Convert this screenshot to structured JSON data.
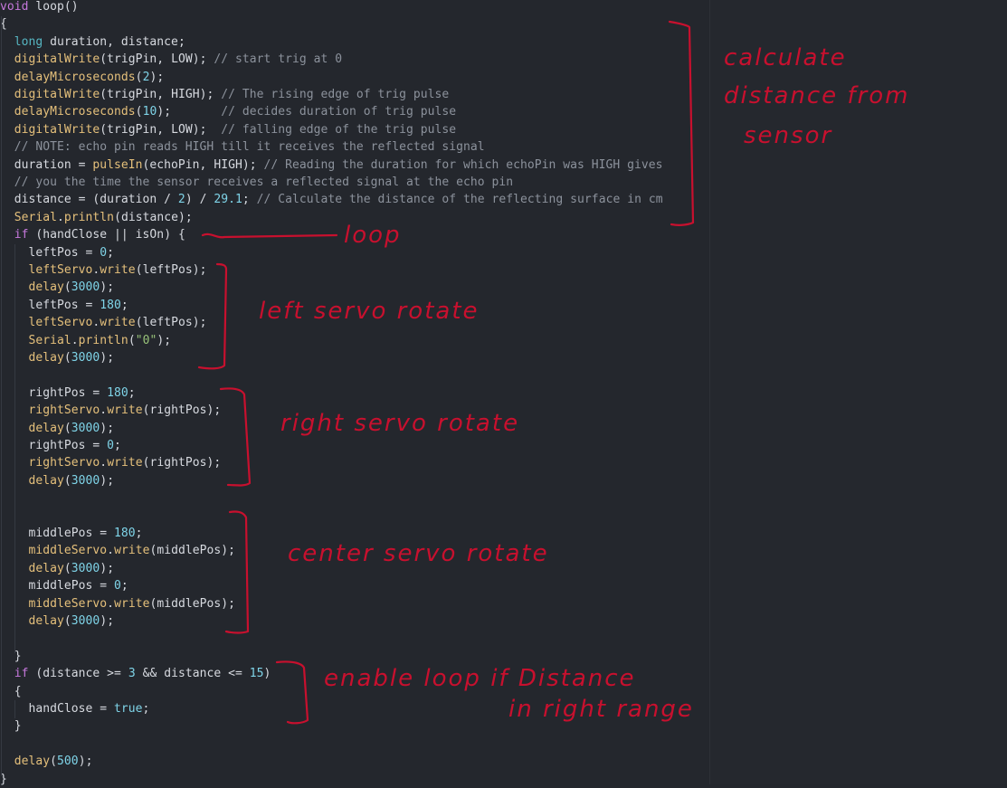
{
  "code": {
    "lines": [
      [
        {
          "t": "void",
          "c": "kw"
        },
        {
          "t": " loop()",
          "c": "punc"
        }
      ],
      [
        {
          "t": "{",
          "c": "punc"
        }
      ],
      [
        {
          "t": "  "
        },
        {
          "t": "long",
          "c": "type"
        },
        {
          "t": " duration, distance;"
        }
      ],
      [
        {
          "t": "  "
        },
        {
          "t": "digitalWrite",
          "c": "fn"
        },
        {
          "t": "(trigPin, LOW); "
        },
        {
          "t": "// start trig at 0",
          "c": "cm"
        }
      ],
      [
        {
          "t": "  "
        },
        {
          "t": "delayMicroseconds",
          "c": "fn"
        },
        {
          "t": "("
        },
        {
          "t": "2",
          "c": "num"
        },
        {
          "t": ");"
        }
      ],
      [
        {
          "t": "  "
        },
        {
          "t": "digitalWrite",
          "c": "fn"
        },
        {
          "t": "(trigPin, HIGH); "
        },
        {
          "t": "// The rising edge of trig pulse",
          "c": "cm"
        }
      ],
      [
        {
          "t": "  "
        },
        {
          "t": "delayMicroseconds",
          "c": "fn"
        },
        {
          "t": "("
        },
        {
          "t": "10",
          "c": "num"
        },
        {
          "t": ");       "
        },
        {
          "t": "// decides duration of trig pulse",
          "c": "cm"
        }
      ],
      [
        {
          "t": "  "
        },
        {
          "t": "digitalWrite",
          "c": "fn"
        },
        {
          "t": "(trigPin, LOW);  "
        },
        {
          "t": "// falling edge of the trig pulse",
          "c": "cm"
        }
      ],
      [
        {
          "t": "  "
        },
        {
          "t": "// NOTE: echo pin reads HIGH till it receives the reflected signal",
          "c": "cm"
        }
      ],
      [
        {
          "t": "  duration = "
        },
        {
          "t": "pulseIn",
          "c": "fn"
        },
        {
          "t": "(echoPin, HIGH); "
        },
        {
          "t": "// Reading the duration for which echoPin was HIGH gives",
          "c": "cm"
        }
      ],
      [
        {
          "t": "  "
        },
        {
          "t": "// you the time the sensor receives a reflected signal at the echo pin",
          "c": "cm"
        }
      ],
      [
        {
          "t": "  distance = (duration / "
        },
        {
          "t": "2",
          "c": "num"
        },
        {
          "t": ") / "
        },
        {
          "t": "29.1",
          "c": "num"
        },
        {
          "t": "; "
        },
        {
          "t": "// Calculate the distance of the reflecting surface in cm",
          "c": "cm"
        }
      ],
      [
        {
          "t": "  "
        },
        {
          "t": "Serial",
          "c": "fn"
        },
        {
          "t": "."
        },
        {
          "t": "println",
          "c": "fn"
        },
        {
          "t": "(distance);"
        }
      ],
      [
        {
          "t": "  "
        },
        {
          "t": "if",
          "c": "kw"
        },
        {
          "t": " (handClose || isOn) {"
        }
      ],
      [
        {
          "t": "    leftPos = "
        },
        {
          "t": "0",
          "c": "num"
        },
        {
          "t": ";"
        }
      ],
      [
        {
          "t": "    "
        },
        {
          "t": "leftServo",
          "c": "fn"
        },
        {
          "t": "."
        },
        {
          "t": "write",
          "c": "fn"
        },
        {
          "t": "(leftPos);"
        }
      ],
      [
        {
          "t": "    "
        },
        {
          "t": "delay",
          "c": "fn"
        },
        {
          "t": "("
        },
        {
          "t": "3000",
          "c": "num"
        },
        {
          "t": ");"
        }
      ],
      [
        {
          "t": "    leftPos = "
        },
        {
          "t": "180",
          "c": "num"
        },
        {
          "t": ";"
        }
      ],
      [
        {
          "t": "    "
        },
        {
          "t": "leftServo",
          "c": "fn"
        },
        {
          "t": "."
        },
        {
          "t": "write",
          "c": "fn"
        },
        {
          "t": "(leftPos);"
        }
      ],
      [
        {
          "t": "    "
        },
        {
          "t": "Serial",
          "c": "fn"
        },
        {
          "t": "."
        },
        {
          "t": "println",
          "c": "fn"
        },
        {
          "t": "("
        },
        {
          "t": "\"0\"",
          "c": "str"
        },
        {
          "t": ");"
        }
      ],
      [
        {
          "t": "    "
        },
        {
          "t": "delay",
          "c": "fn"
        },
        {
          "t": "("
        },
        {
          "t": "3000",
          "c": "num"
        },
        {
          "t": ");"
        }
      ],
      [
        {
          "t": ""
        }
      ],
      [
        {
          "t": "    rightPos = "
        },
        {
          "t": "180",
          "c": "num"
        },
        {
          "t": ";"
        }
      ],
      [
        {
          "t": "    "
        },
        {
          "t": "rightServo",
          "c": "fn"
        },
        {
          "t": "."
        },
        {
          "t": "write",
          "c": "fn"
        },
        {
          "t": "(rightPos);"
        }
      ],
      [
        {
          "t": "    "
        },
        {
          "t": "delay",
          "c": "fn"
        },
        {
          "t": "("
        },
        {
          "t": "3000",
          "c": "num"
        },
        {
          "t": ");"
        }
      ],
      [
        {
          "t": "    rightPos = "
        },
        {
          "t": "0",
          "c": "num"
        },
        {
          "t": ";"
        }
      ],
      [
        {
          "t": "    "
        },
        {
          "t": "rightServo",
          "c": "fn"
        },
        {
          "t": "."
        },
        {
          "t": "write",
          "c": "fn"
        },
        {
          "t": "(rightPos);"
        }
      ],
      [
        {
          "t": "    "
        },
        {
          "t": "delay",
          "c": "fn"
        },
        {
          "t": "("
        },
        {
          "t": "3000",
          "c": "num"
        },
        {
          "t": ");"
        }
      ],
      [
        {
          "t": ""
        }
      ],
      [
        {
          "t": ""
        }
      ],
      [
        {
          "t": "    middlePos = "
        },
        {
          "t": "180",
          "c": "num"
        },
        {
          "t": ";"
        }
      ],
      [
        {
          "t": "    "
        },
        {
          "t": "middleServo",
          "c": "fn"
        },
        {
          "t": "."
        },
        {
          "t": "write",
          "c": "fn"
        },
        {
          "t": "(middlePos);"
        }
      ],
      [
        {
          "t": "    "
        },
        {
          "t": "delay",
          "c": "fn"
        },
        {
          "t": "("
        },
        {
          "t": "3000",
          "c": "num"
        },
        {
          "t": ");"
        }
      ],
      [
        {
          "t": "    middlePos = "
        },
        {
          "t": "0",
          "c": "num"
        },
        {
          "t": ";"
        }
      ],
      [
        {
          "t": "    "
        },
        {
          "t": "middleServo",
          "c": "fn"
        },
        {
          "t": "."
        },
        {
          "t": "write",
          "c": "fn"
        },
        {
          "t": "(middlePos);"
        }
      ],
      [
        {
          "t": "    "
        },
        {
          "t": "delay",
          "c": "fn"
        },
        {
          "t": "("
        },
        {
          "t": "3000",
          "c": "num"
        },
        {
          "t": ");"
        }
      ],
      [
        {
          "t": ""
        }
      ],
      [
        {
          "t": "  }"
        }
      ],
      [
        {
          "t": "  "
        },
        {
          "t": "if",
          "c": "kw"
        },
        {
          "t": " (distance >= "
        },
        {
          "t": "3",
          "c": "num"
        },
        {
          "t": " && distance <= "
        },
        {
          "t": "15",
          "c": "num"
        },
        {
          "t": ")"
        }
      ],
      [
        {
          "t": "  {"
        }
      ],
      [
        {
          "t": "    handClose = "
        },
        {
          "t": "true",
          "c": "num"
        },
        {
          "t": ";"
        }
      ],
      [
        {
          "t": "  }"
        }
      ],
      [
        {
          "t": ""
        }
      ],
      [
        {
          "t": "  "
        },
        {
          "t": "delay",
          "c": "fn"
        },
        {
          "t": "("
        },
        {
          "t": "500",
          "c": "num"
        },
        {
          "t": ");"
        }
      ],
      [
        {
          "t": "}"
        }
      ]
    ]
  },
  "annotations": {
    "calculate": [
      "calculate",
      "distance from",
      "sensor"
    ],
    "loop": "loop",
    "left_servo": "left servo rotate",
    "right_servo": "right servo rotate",
    "center_servo": "center servo rotate",
    "enable": [
      "enable loop if Distance",
      "in right range"
    ],
    "color": "#c8102e"
  },
  "theme": {
    "background": "#24272d",
    "keyword": "#c678dd",
    "type": "#56b6c2",
    "function": "#e5c07b",
    "number": "#7fd4e8",
    "comment": "#8c929c",
    "text": "#d7dae0"
  }
}
